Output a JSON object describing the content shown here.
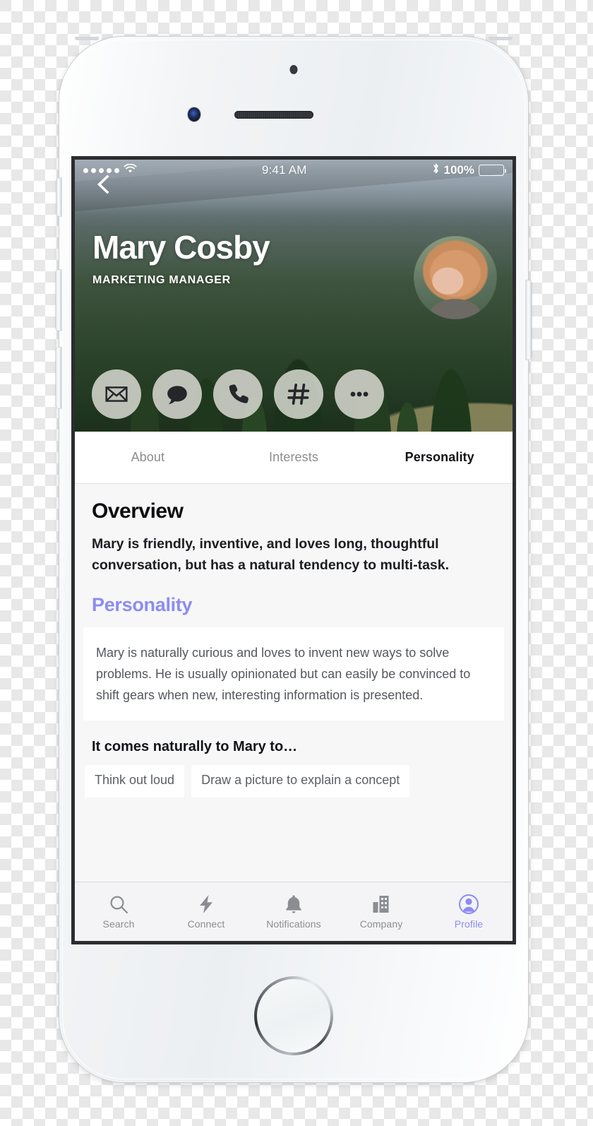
{
  "status_bar": {
    "signal_dots": 5,
    "wifi_icon": "wifi-icon",
    "time": "9:41 AM",
    "bluetooth_icon": "bluetooth-icon",
    "battery_percent": "100%",
    "battery_level": 100
  },
  "hero": {
    "back_icon": "chevron-left-icon",
    "name": "Mary Cosby",
    "role": "MARKETING MANAGER",
    "avatar_name": "profile-avatar",
    "actions": [
      {
        "id": "email",
        "icon": "envelope-icon"
      },
      {
        "id": "message",
        "icon": "chat-bubble-icon"
      },
      {
        "id": "call",
        "icon": "phone-icon"
      },
      {
        "id": "tag",
        "icon": "hashtag-icon"
      },
      {
        "id": "more",
        "icon": "ellipsis-icon"
      }
    ]
  },
  "tabs": [
    {
      "label": "About",
      "active": false
    },
    {
      "label": "Interests",
      "active": false
    },
    {
      "label": "Personality",
      "active": true
    }
  ],
  "content": {
    "section_title": "Overview",
    "overview_text": "Mary is friendly, inventive, and loves long, thoughtful conversation, but has a natural tendency to multi-task.",
    "personality_heading": "Personality",
    "personality_body": "Mary is naturally curious and loves to invent new ways to solve problems. He is usually opinionated but can easily be convinced to shift gears when new, interesting information is presented.",
    "naturally_heading": "It comes naturally to Mary to…",
    "chips": [
      "Think out loud",
      "Draw a picture to explain a concept"
    ]
  },
  "bottom_nav": [
    {
      "label": "Search",
      "icon": "search-icon",
      "active": false
    },
    {
      "label": "Connect",
      "icon": "lightning-bolt-icon",
      "active": false
    },
    {
      "label": "Notifications",
      "icon": "bell-icon",
      "active": false
    },
    {
      "label": "Company",
      "icon": "buildings-icon",
      "active": false
    },
    {
      "label": "Profile",
      "icon": "person-circle-icon",
      "active": true
    }
  ],
  "colors": {
    "accent_purple": "#8c8cf2",
    "tab_active": "#101114",
    "tab_inactive": "#8d8d8d",
    "body_text": "#54585e",
    "screen_bg": "#f7f7f7"
  }
}
